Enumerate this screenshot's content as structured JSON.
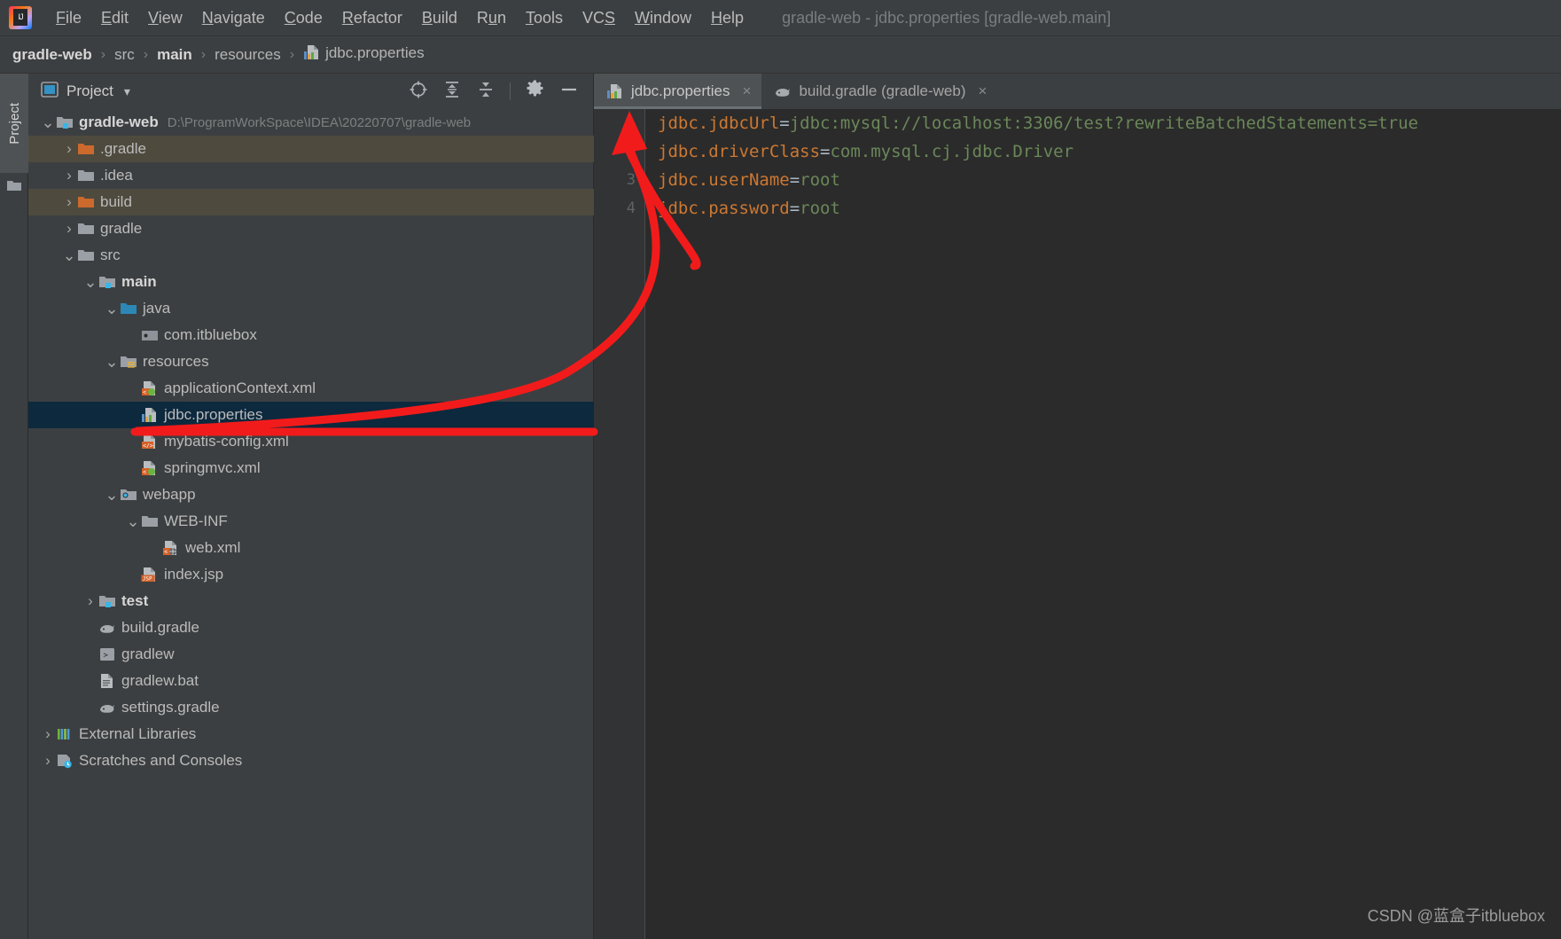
{
  "window": {
    "title": "gradle-web - jdbc.properties [gradle-web.main]"
  },
  "menubar": {
    "logo_text": "IJ",
    "items": [
      {
        "name": "file",
        "label": "File",
        "mnemonic": "F"
      },
      {
        "name": "edit",
        "label": "Edit",
        "mnemonic": "E"
      },
      {
        "name": "view",
        "label": "View",
        "mnemonic": "V"
      },
      {
        "name": "navigate",
        "label": "Navigate",
        "mnemonic": "N"
      },
      {
        "name": "code",
        "label": "Code",
        "mnemonic": "C"
      },
      {
        "name": "refactor",
        "label": "Refactor",
        "mnemonic": "R"
      },
      {
        "name": "build",
        "label": "Build",
        "mnemonic": "B"
      },
      {
        "name": "run",
        "label": "Run",
        "mnemonic": "u"
      },
      {
        "name": "tools",
        "label": "Tools",
        "mnemonic": "T"
      },
      {
        "name": "vcs",
        "label": "VCS",
        "mnemonic": "S"
      },
      {
        "name": "window",
        "label": "Window",
        "mnemonic": "W"
      },
      {
        "name": "help",
        "label": "Help",
        "mnemonic": "H"
      }
    ]
  },
  "breadcrumb": {
    "items": [
      {
        "label": "gradle-web",
        "bold": true,
        "icon": ""
      },
      {
        "label": "src",
        "bold": false,
        "icon": ""
      },
      {
        "label": "main",
        "bold": true,
        "icon": ""
      },
      {
        "label": "resources",
        "bold": false,
        "icon": ""
      },
      {
        "label": "jdbc.properties",
        "bold": false,
        "icon": "properties-file-icon"
      }
    ],
    "separator": "›"
  },
  "toolstrip": {
    "project_tab_label": "Project",
    "folder_icon": "folder-icon"
  },
  "project_panel": {
    "title": "Project",
    "caret": "▾",
    "actions": [
      {
        "name": "select-opened-file-icon",
        "label": "Select Opened File"
      },
      {
        "name": "expand-all-icon",
        "label": "Expand All"
      },
      {
        "name": "collapse-all-icon",
        "label": "Collapse All"
      },
      {
        "name": "settings-gear-icon",
        "label": "Settings"
      },
      {
        "name": "hide-icon",
        "label": "Hide"
      }
    ],
    "tree": [
      {
        "name": "node-gradle-web",
        "label": "gradle-web",
        "path": "D:\\ProgramWorkSpace\\IDEA\\20220707\\gradle-web",
        "indent": 0,
        "arrow": "expanded",
        "icon": "module-folder-icon",
        "bold": true,
        "state": "normal"
      },
      {
        "name": "node-dot-gradle",
        "label": ".gradle",
        "path": "",
        "indent": 1,
        "arrow": "collapsed",
        "icon": "excluded-folder-icon",
        "bold": false,
        "state": "dirty"
      },
      {
        "name": "node-dot-idea",
        "label": ".idea",
        "path": "",
        "indent": 1,
        "arrow": "collapsed",
        "icon": "folder-icon",
        "bold": false,
        "state": "normal"
      },
      {
        "name": "node-build",
        "label": "build",
        "path": "",
        "indent": 1,
        "arrow": "collapsed",
        "icon": "excluded-folder-icon",
        "bold": false,
        "state": "dirty"
      },
      {
        "name": "node-gradle",
        "label": "gradle",
        "path": "",
        "indent": 1,
        "arrow": "collapsed",
        "icon": "folder-icon",
        "bold": false,
        "state": "normal"
      },
      {
        "name": "node-src",
        "label": "src",
        "path": "",
        "indent": 1,
        "arrow": "expanded",
        "icon": "folder-icon",
        "bold": false,
        "state": "normal"
      },
      {
        "name": "node-main",
        "label": "main",
        "path": "",
        "indent": 2,
        "arrow": "expanded",
        "icon": "module-folder-icon",
        "bold": true,
        "state": "normal"
      },
      {
        "name": "node-java",
        "label": "java",
        "path": "",
        "indent": 3,
        "arrow": "expanded",
        "icon": "sources-folder-icon",
        "bold": false,
        "state": "normal"
      },
      {
        "name": "node-com-itbluebox",
        "label": "com.itbluebox",
        "path": "",
        "indent": 4,
        "arrow": "none",
        "icon": "package-icon",
        "bold": false,
        "state": "normal"
      },
      {
        "name": "node-resources",
        "label": "resources",
        "path": "",
        "indent": 3,
        "arrow": "expanded",
        "icon": "resources-folder-icon",
        "bold": false,
        "state": "normal"
      },
      {
        "name": "node-application-context-xml",
        "label": "applicationContext.xml",
        "path": "",
        "indent": 4,
        "arrow": "none",
        "icon": "spring-xml-icon",
        "bold": false,
        "state": "normal"
      },
      {
        "name": "node-jdbc-properties",
        "label": "jdbc.properties",
        "path": "",
        "indent": 4,
        "arrow": "none",
        "icon": "properties-file-icon",
        "bold": false,
        "state": "selected"
      },
      {
        "name": "node-mybatis-config-xml",
        "label": "mybatis-config.xml",
        "path": "",
        "indent": 4,
        "arrow": "none",
        "icon": "xml-file-icon",
        "bold": false,
        "state": "normal"
      },
      {
        "name": "node-springmvc-xml",
        "label": "springmvc.xml",
        "path": "",
        "indent": 4,
        "arrow": "none",
        "icon": "spring-xml-icon",
        "bold": false,
        "state": "normal"
      },
      {
        "name": "node-webapp",
        "label": "webapp",
        "path": "",
        "indent": 3,
        "arrow": "expanded",
        "icon": "web-folder-icon",
        "bold": false,
        "state": "normal"
      },
      {
        "name": "node-web-inf",
        "label": "WEB-INF",
        "path": "",
        "indent": 4,
        "arrow": "expanded",
        "icon": "folder-icon",
        "bold": false,
        "state": "normal"
      },
      {
        "name": "node-web-xml",
        "label": "web.xml",
        "path": "",
        "indent": 5,
        "arrow": "none",
        "icon": "web-xml-icon",
        "bold": false,
        "state": "normal"
      },
      {
        "name": "node-index-jsp",
        "label": "index.jsp",
        "path": "",
        "indent": 4,
        "arrow": "none",
        "icon": "jsp-file-icon",
        "bold": false,
        "state": "normal"
      },
      {
        "name": "node-test",
        "label": "test",
        "path": "",
        "indent": 2,
        "arrow": "collapsed",
        "icon": "module-folder-icon",
        "bold": true,
        "state": "normal"
      },
      {
        "name": "node-build-gradle",
        "label": "build.gradle",
        "path": "",
        "indent": 2,
        "arrow": "none",
        "icon": "gradle-icon",
        "bold": false,
        "state": "normal"
      },
      {
        "name": "node-gradlew",
        "label": "gradlew",
        "path": "",
        "indent": 2,
        "arrow": "none",
        "icon": "shell-script-icon",
        "bold": false,
        "state": "normal"
      },
      {
        "name": "node-gradlew-bat",
        "label": "gradlew.bat",
        "path": "",
        "indent": 2,
        "arrow": "none",
        "icon": "bat-file-icon",
        "bold": false,
        "state": "normal"
      },
      {
        "name": "node-settings-gradle",
        "label": "settings.gradle",
        "path": "",
        "indent": 2,
        "arrow": "none",
        "icon": "gradle-icon",
        "bold": false,
        "state": "normal"
      },
      {
        "name": "node-external-libraries",
        "label": "External Libraries",
        "path": "",
        "indent": 0,
        "arrow": "collapsed",
        "icon": "libraries-icon",
        "bold": false,
        "state": "normal"
      },
      {
        "name": "node-scratches-and-consoles",
        "label": "Scratches and Consoles",
        "path": "",
        "indent": 0,
        "arrow": "collapsed",
        "icon": "scratches-icon",
        "bold": false,
        "state": "normal"
      }
    ]
  },
  "editor": {
    "tabs": [
      {
        "name": "tab-jdbc-properties",
        "label": "jdbc.properties",
        "icon": "properties-file-icon",
        "active": true,
        "close": "×"
      },
      {
        "name": "tab-build-gradle",
        "label": "build.gradle (gradle-web)",
        "icon": "gradle-icon",
        "active": false,
        "close": "×"
      }
    ],
    "line_numbers": [
      "1",
      "2",
      "3",
      "4"
    ],
    "lines": [
      {
        "key": "jdbc.jdbcUrl",
        "eq": "=",
        "value": "jdbc:mysql://localhost:3306/test?rewriteBatchedStatements=true"
      },
      {
        "key": "jdbc.driverClass",
        "eq": "=",
        "value": "com.mysql.cj.jdbc.Driver"
      },
      {
        "key": "jdbc.userName",
        "eq": "=",
        "value": "root"
      },
      {
        "key": "jdbc.password",
        "eq": "=",
        "value": "root"
      }
    ]
  },
  "annotation": {
    "name": "red-arrow-and-underline",
    "color": "#f21b1b",
    "description": "Red arrow from jdbc.properties tree node to the editor tab, plus red underline under the selected tree node"
  },
  "watermark": {
    "text": "CSDN @蓝盒子itbluebox"
  },
  "colors": {
    "background": "#3c3f41",
    "editor_background": "#2b2b2b",
    "selection": "#0d293e",
    "dirty_row": "#4e4a3e",
    "key_color": "#cc7832",
    "value_color": "#6a8759",
    "accent_red": "#f21b1b"
  }
}
